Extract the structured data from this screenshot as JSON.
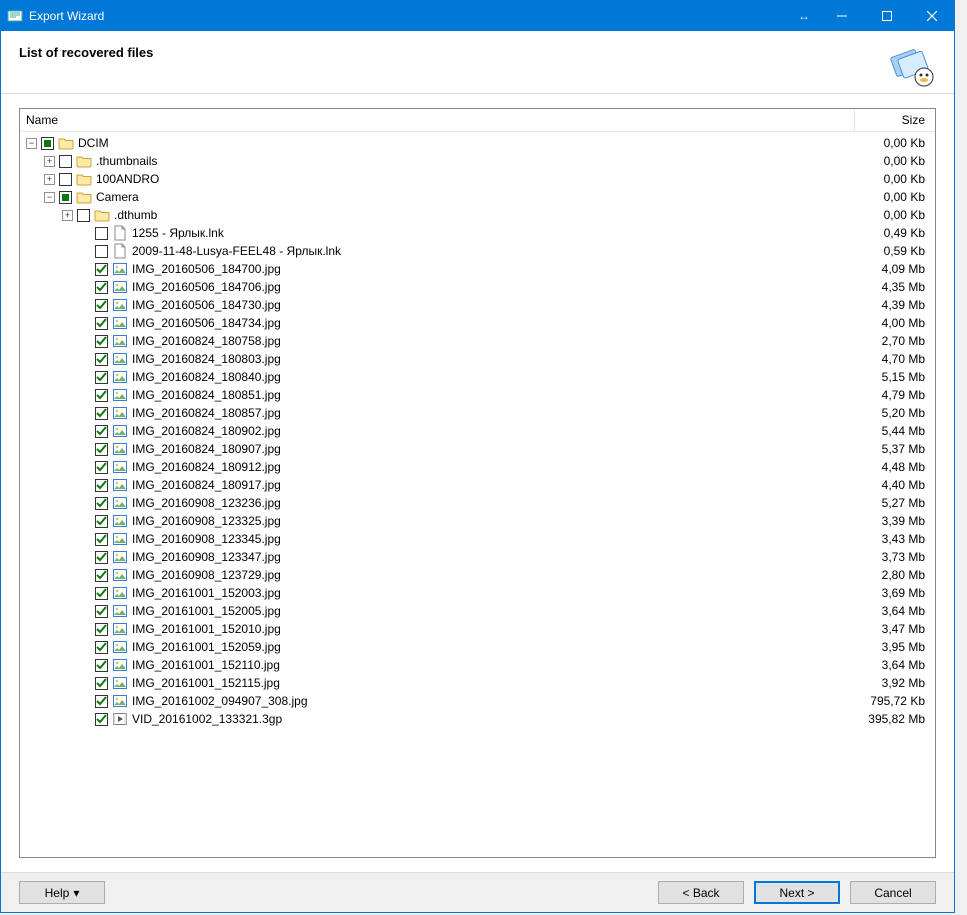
{
  "window": {
    "title": "Export Wizard"
  },
  "header": {
    "heading": "List of recovered files"
  },
  "columns": {
    "name": "Name",
    "size": "Size"
  },
  "buttons": {
    "help": "Help",
    "back": "< Back",
    "next": "Next >",
    "cancel": "Cancel"
  },
  "tree": [
    {
      "depth": 0,
      "expander": "minus",
      "check": "partial",
      "icon": "folder",
      "name": "DCIM",
      "size": "0,00 Kb"
    },
    {
      "depth": 1,
      "expander": "plus",
      "check": "empty",
      "icon": "folder",
      "name": ".thumbnails",
      "size": "0,00 Kb"
    },
    {
      "depth": 1,
      "expander": "plus",
      "check": "empty",
      "icon": "folder",
      "name": "100ANDRO",
      "size": "0,00 Kb"
    },
    {
      "depth": 1,
      "expander": "minus",
      "check": "partial",
      "icon": "folder",
      "name": "Camera",
      "size": "0,00 Kb"
    },
    {
      "depth": 2,
      "expander": "plus",
      "check": "empty",
      "icon": "folder",
      "name": ".dthumb",
      "size": "0,00 Kb"
    },
    {
      "depth": 3,
      "expander": "blank",
      "check": "empty",
      "icon": "file",
      "name": "1255 - Ярлык.lnk",
      "size": "0,49 Kb"
    },
    {
      "depth": 3,
      "expander": "blank",
      "check": "empty",
      "icon": "file",
      "name": "2009-11-48-Lusya-FEEL48 - Ярлык.lnk",
      "size": "0,59 Kb"
    },
    {
      "depth": 3,
      "expander": "blank",
      "check": "checked",
      "icon": "image",
      "name": "IMG_20160506_184700.jpg",
      "size": "4,09 Mb"
    },
    {
      "depth": 3,
      "expander": "blank",
      "check": "checked",
      "icon": "image",
      "name": "IMG_20160506_184706.jpg",
      "size": "4,35 Mb"
    },
    {
      "depth": 3,
      "expander": "blank",
      "check": "checked",
      "icon": "image",
      "name": "IMG_20160506_184730.jpg",
      "size": "4,39 Mb"
    },
    {
      "depth": 3,
      "expander": "blank",
      "check": "checked",
      "icon": "image",
      "name": "IMG_20160506_184734.jpg",
      "size": "4,00 Mb"
    },
    {
      "depth": 3,
      "expander": "blank",
      "check": "checked",
      "icon": "image",
      "name": "IMG_20160824_180758.jpg",
      "size": "2,70 Mb"
    },
    {
      "depth": 3,
      "expander": "blank",
      "check": "checked",
      "icon": "image",
      "name": "IMG_20160824_180803.jpg",
      "size": "4,70 Mb"
    },
    {
      "depth": 3,
      "expander": "blank",
      "check": "checked",
      "icon": "image",
      "name": "IMG_20160824_180840.jpg",
      "size": "5,15 Mb"
    },
    {
      "depth": 3,
      "expander": "blank",
      "check": "checked",
      "icon": "image",
      "name": "IMG_20160824_180851.jpg",
      "size": "4,79 Mb"
    },
    {
      "depth": 3,
      "expander": "blank",
      "check": "checked",
      "icon": "image",
      "name": "IMG_20160824_180857.jpg",
      "size": "5,20 Mb"
    },
    {
      "depth": 3,
      "expander": "blank",
      "check": "checked",
      "icon": "image",
      "name": "IMG_20160824_180902.jpg",
      "size": "5,44 Mb"
    },
    {
      "depth": 3,
      "expander": "blank",
      "check": "checked",
      "icon": "image",
      "name": "IMG_20160824_180907.jpg",
      "size": "5,37 Mb"
    },
    {
      "depth": 3,
      "expander": "blank",
      "check": "checked",
      "icon": "image",
      "name": "IMG_20160824_180912.jpg",
      "size": "4,48 Mb"
    },
    {
      "depth": 3,
      "expander": "blank",
      "check": "checked",
      "icon": "image",
      "name": "IMG_20160824_180917.jpg",
      "size": "4,40 Mb"
    },
    {
      "depth": 3,
      "expander": "blank",
      "check": "checked",
      "icon": "image",
      "name": "IMG_20160908_123236.jpg",
      "size": "5,27 Mb"
    },
    {
      "depth": 3,
      "expander": "blank",
      "check": "checked",
      "icon": "image",
      "name": "IMG_20160908_123325.jpg",
      "size": "3,39 Mb"
    },
    {
      "depth": 3,
      "expander": "blank",
      "check": "checked",
      "icon": "image",
      "name": "IMG_20160908_123345.jpg",
      "size": "3,43 Mb"
    },
    {
      "depth": 3,
      "expander": "blank",
      "check": "checked",
      "icon": "image",
      "name": "IMG_20160908_123347.jpg",
      "size": "3,73 Mb"
    },
    {
      "depth": 3,
      "expander": "blank",
      "check": "checked",
      "icon": "image",
      "name": "IMG_20160908_123729.jpg",
      "size": "2,80 Mb"
    },
    {
      "depth": 3,
      "expander": "blank",
      "check": "checked",
      "icon": "image",
      "name": "IMG_20161001_152003.jpg",
      "size": "3,69 Mb"
    },
    {
      "depth": 3,
      "expander": "blank",
      "check": "checked",
      "icon": "image",
      "name": "IMG_20161001_152005.jpg",
      "size": "3,64 Mb"
    },
    {
      "depth": 3,
      "expander": "blank",
      "check": "checked",
      "icon": "image",
      "name": "IMG_20161001_152010.jpg",
      "size": "3,47 Mb"
    },
    {
      "depth": 3,
      "expander": "blank",
      "check": "checked",
      "icon": "image",
      "name": "IMG_20161001_152059.jpg",
      "size": "3,95 Mb"
    },
    {
      "depth": 3,
      "expander": "blank",
      "check": "checked",
      "icon": "image",
      "name": "IMG_20161001_152110.jpg",
      "size": "3,64 Mb"
    },
    {
      "depth": 3,
      "expander": "blank",
      "check": "checked",
      "icon": "image",
      "name": "IMG_20161001_152115.jpg",
      "size": "3,92 Mb"
    },
    {
      "depth": 3,
      "expander": "blank",
      "check": "checked",
      "icon": "image",
      "name": "IMG_20161002_094907_308.jpg",
      "size": "795,72 Kb"
    },
    {
      "depth": 3,
      "expander": "blank",
      "check": "checked",
      "icon": "video",
      "name": "VID_20161002_133321.3gp",
      "size": "395,82 Mb"
    }
  ]
}
